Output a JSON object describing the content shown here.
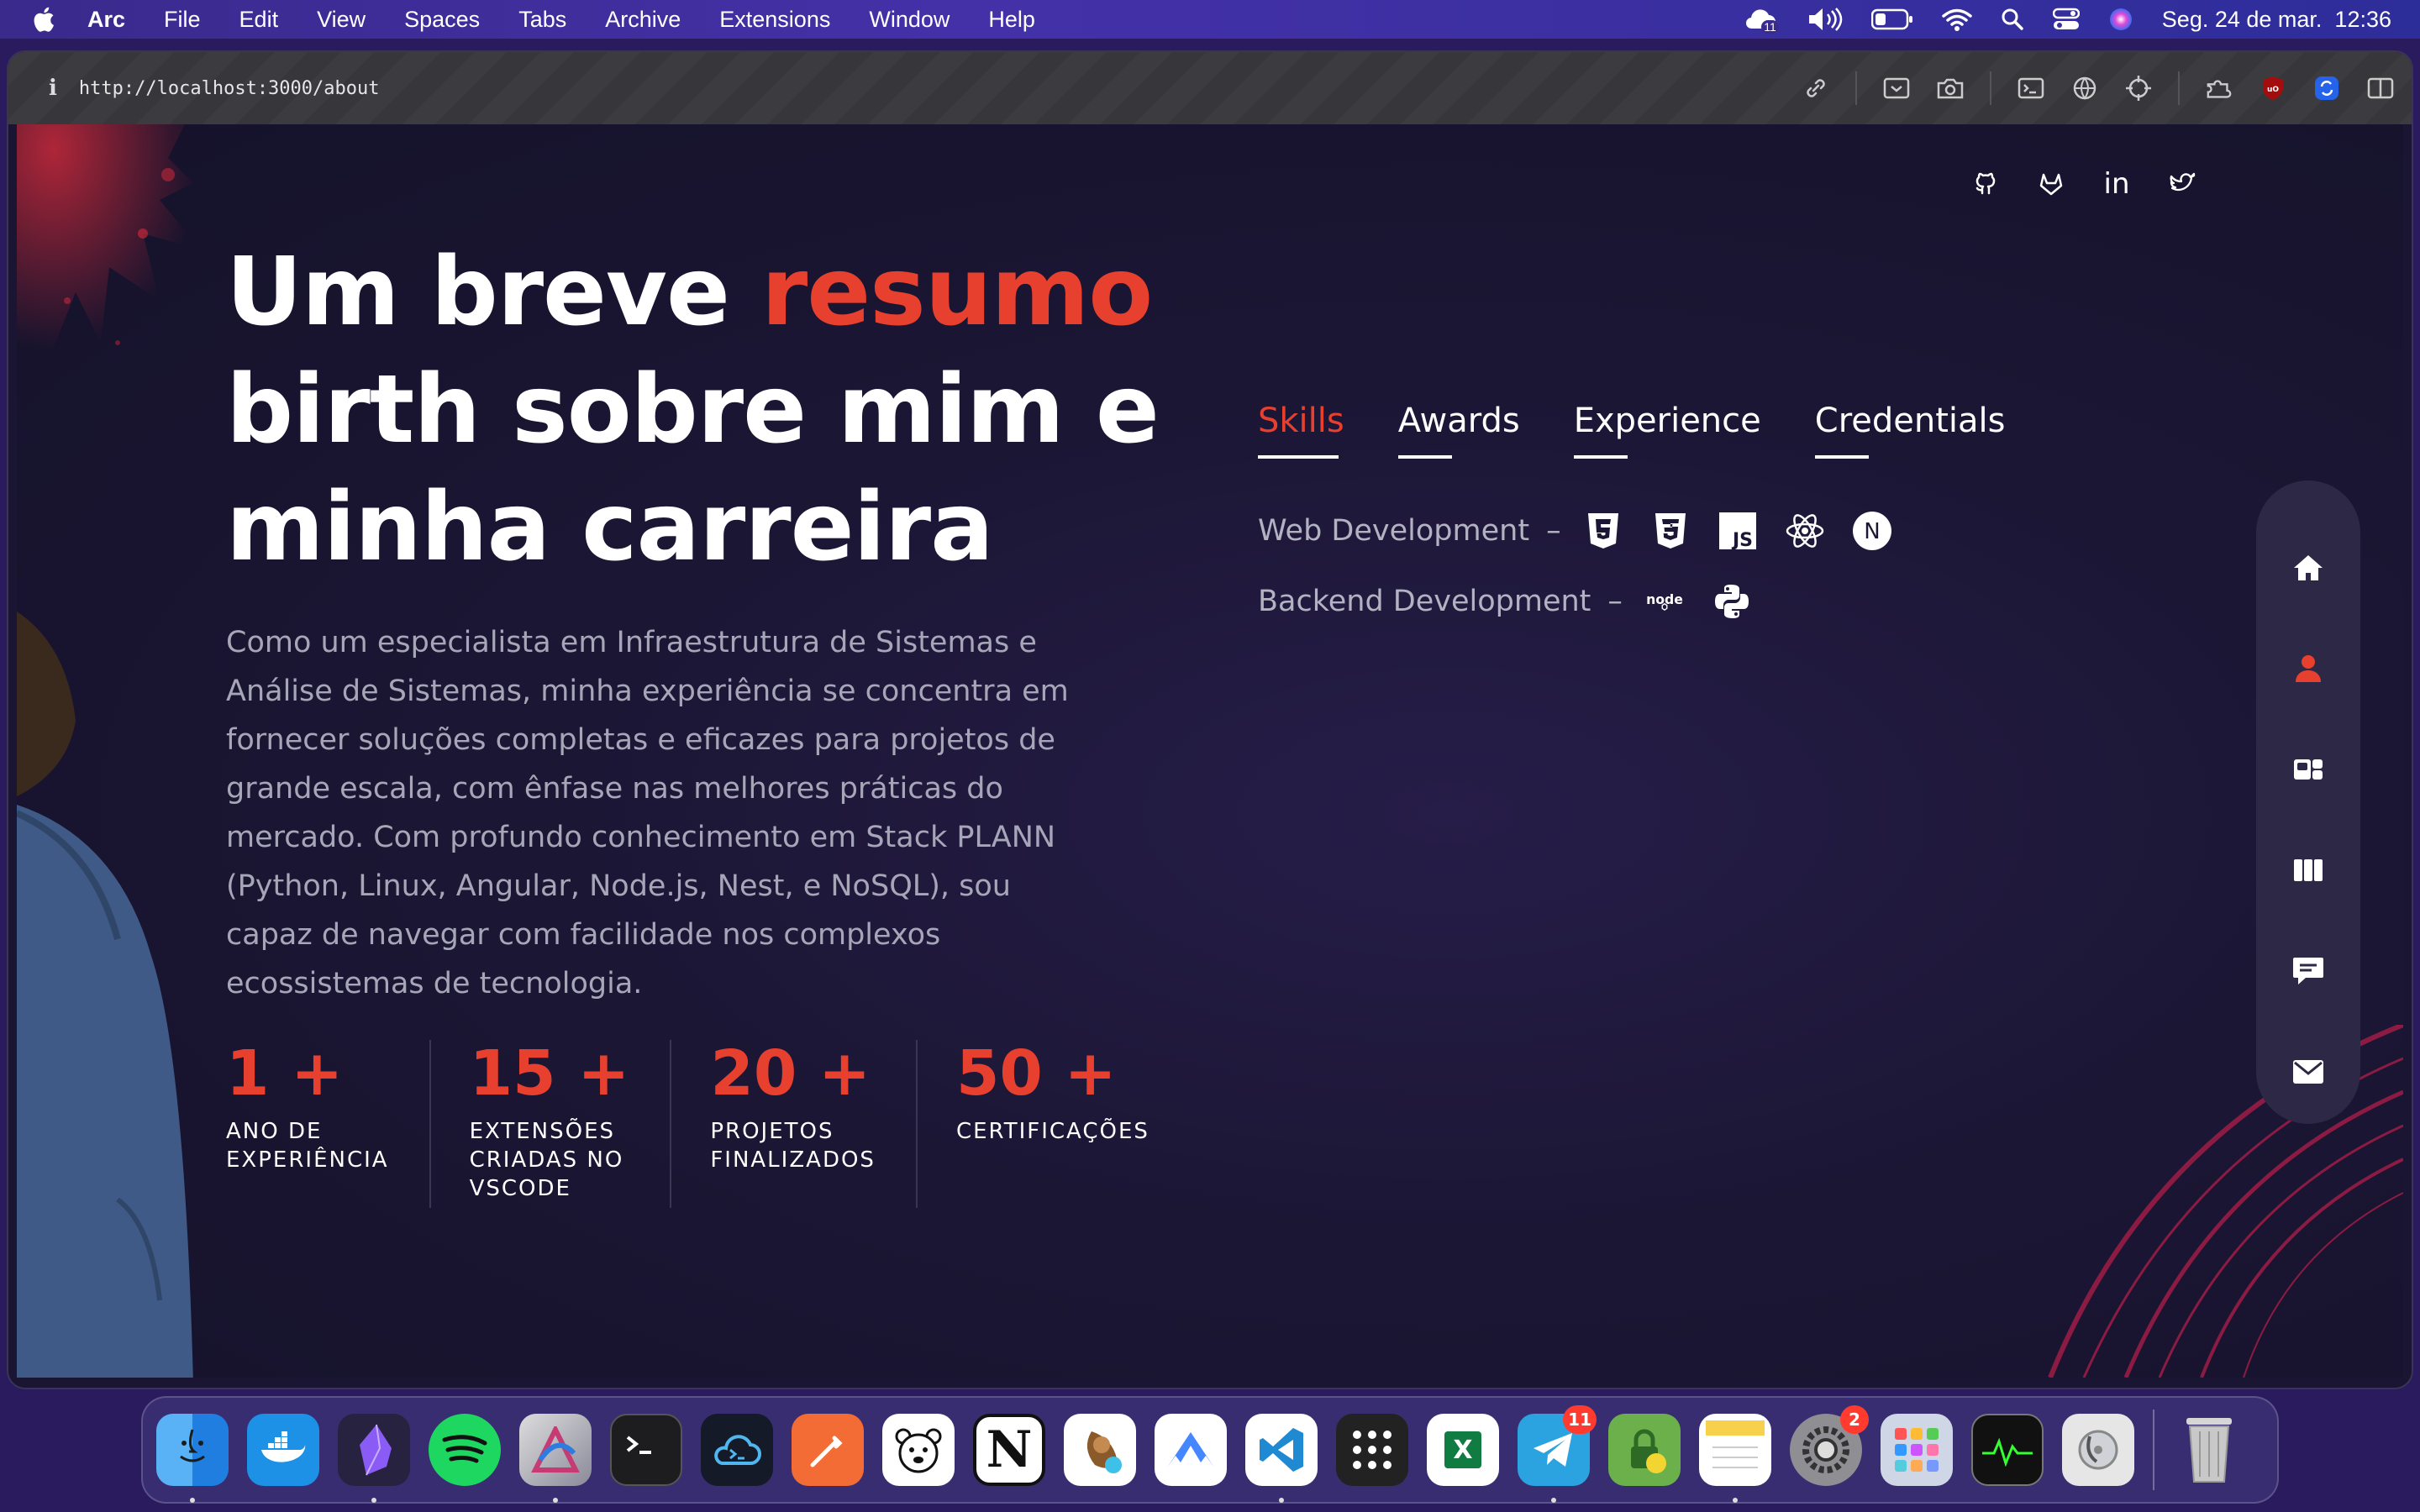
{
  "menubar": {
    "app": "Arc",
    "items": [
      "File",
      "Edit",
      "View",
      "Spaces",
      "Tabs",
      "Archive",
      "Extensions",
      "Window",
      "Help"
    ],
    "badge_count": "11",
    "datetime": "Seg. 24 de mar.  12:36"
  },
  "browser": {
    "info_icon_label": "i",
    "url": "http://localhost:3000/about"
  },
  "hero": {
    "title_part1": "Um breve ",
    "title_accent": "resumo",
    "title_part2": "birth sobre mim e minha carreira",
    "text": "Como um especialista em Infraestrutura de Sistemas e Análise de Sistemas, minha experiência se concentra em fornecer soluções completas e eficazes para projetos de grande escala, com ênfase nas melhores práticas do mercado. Com profundo conhecimento em Stack PLANN (Python, Linux, Angular, Node.js, Nest, e NoSQL), sou capaz de navegar com facilidade nos complexos ecossistemas de tecnologia."
  },
  "stats": [
    {
      "number": "1 +",
      "label": "ANO DE\nEXPERIÊNCIA"
    },
    {
      "number": "15 +",
      "label": "EXTENSÕES\nCRIADAS NO\nVSCODE"
    },
    {
      "number": "20 +",
      "label": "PROJETOS\nFINALIZADOS"
    },
    {
      "number": "50 +",
      "label": "CERTIFICAÇÕES"
    }
  ],
  "tabs": [
    "Skills",
    "Awards",
    "Experience",
    "Credentials"
  ],
  "skills": [
    {
      "label": "Web Development",
      "icons": [
        "html5-icon",
        "css3-icon",
        "javascript-icon",
        "react-icon",
        "nextjs-icon"
      ]
    },
    {
      "label": "Backend Development",
      "icons": [
        "nodejs-icon",
        "python-icon"
      ]
    }
  ],
  "skill_icon_text": {
    "js": "JS",
    "next": "N",
    "node": "node"
  },
  "socials": [
    "github-icon",
    "gitlab-icon",
    "linkedin-icon",
    "twitter-icon"
  ],
  "social_text": {
    "linkedin": "in"
  },
  "sidenav": [
    "home-icon",
    "user-icon",
    "services-icon",
    "work-icon",
    "testimonials-icon",
    "mail-icon"
  ],
  "dock": {
    "apps": [
      "finder",
      "docker",
      "obsidian",
      "spotify",
      "affinity",
      "terminal",
      "cloud-terminal",
      "postman",
      "bear",
      "notion",
      "tableplus",
      "nordvpn",
      "vscode",
      "launchpad-grid",
      "excel",
      "telegram",
      "keepassxc",
      "notes",
      "system-settings",
      "launchpad",
      "activity-monitor",
      "disk-utility",
      "trash"
    ],
    "telegram_badge": "11",
    "settings_badge": "2",
    "excel_letter": "X",
    "notion_letter": "N"
  },
  "colors": {
    "accent": "#e8402e",
    "background": "#1b1634"
  }
}
